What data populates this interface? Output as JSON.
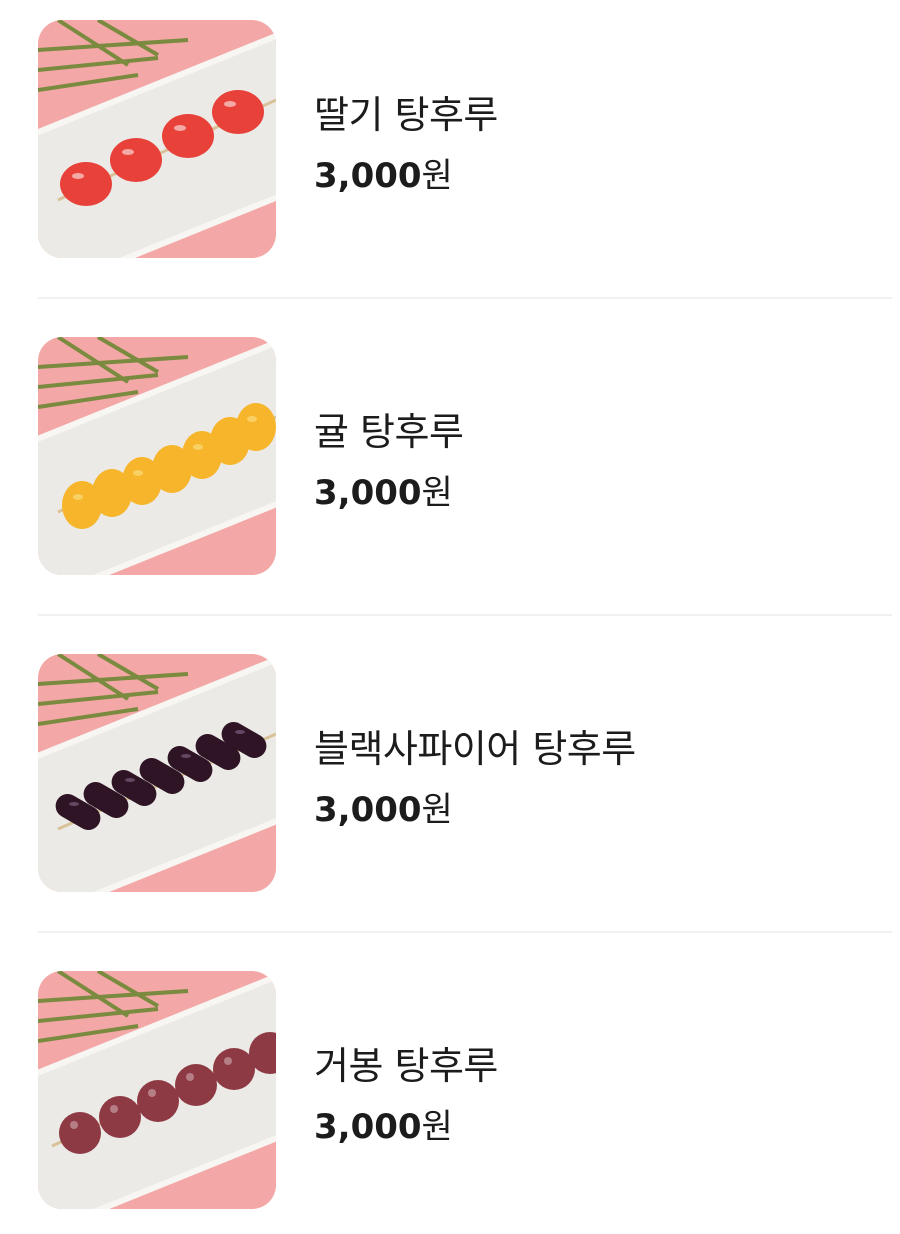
{
  "menu": {
    "items": [
      {
        "name": "딸기 탕후루",
        "price": "3,000",
        "currency": "원",
        "fruit": "strawberry",
        "fruit_color": "#e8413a"
      },
      {
        "name": "귤 탕후루",
        "price": "3,000",
        "currency": "원",
        "fruit": "mandarin",
        "fruit_color": "#f6b52b"
      },
      {
        "name": "블랙사파이어 탕후루",
        "price": "3,000",
        "currency": "원",
        "fruit": "black-sapphire-grape",
        "fruit_color": "#2e1424"
      },
      {
        "name": "거봉 탕후루",
        "price": "3,000",
        "currency": "원",
        "fruit": "kyoho-grape",
        "fruit_color": "#8e3a44"
      }
    ]
  },
  "colors": {
    "background_pink": "#f3a7a6",
    "plate": "#eceae6",
    "leaf": "#7a8a3e",
    "divider": "#f1f1f1"
  }
}
